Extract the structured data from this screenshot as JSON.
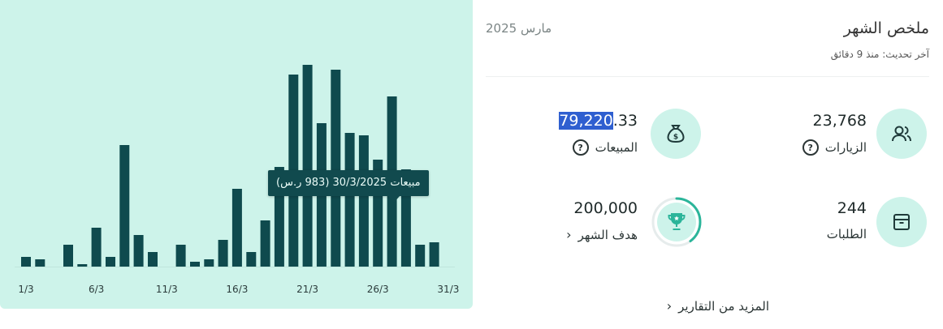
{
  "chart_data": {
    "type": "bar",
    "categories": [
      "1/3",
      "2/3",
      "3/3",
      "4/3",
      "5/3",
      "6/3",
      "7/3",
      "8/3",
      "9/3",
      "10/3",
      "11/3",
      "12/3",
      "13/3",
      "14/3",
      "15/3",
      "16/3",
      "17/3",
      "18/3",
      "19/3",
      "20/3",
      "21/3",
      "22/3",
      "23/3",
      "24/3",
      "25/3",
      "26/3",
      "27/3",
      "28/3",
      "29/3",
      "30/3",
      "31/3"
    ],
    "values": [
      4,
      3,
      0,
      9,
      1,
      16,
      4,
      50,
      13,
      6,
      0,
      9,
      2,
      3,
      11,
      32,
      6,
      19,
      41,
      79,
      83,
      59,
      81,
      55,
      54,
      44,
      70,
      40,
      9,
      10,
      0
    ],
    "tick_labels": [
      "1/3",
      "6/3",
      "11/3",
      "16/3",
      "21/3",
      "26/3",
      "31/3"
    ],
    "bar_color": "#0f4a4e",
    "ylim": [
      0,
      100
    ],
    "grid": false
  },
  "tooltip": {
    "text": "مبيعات 30/3/2025 (983 ر.س)"
  },
  "summary": {
    "title": "ملخص الشهر",
    "period": "مارس 2025",
    "updated": "آخر تحديث: منذ 9 دقائق",
    "metrics": {
      "visits": {
        "value": "23,768",
        "label": "الزيارات",
        "icon": "users-icon"
      },
      "sales": {
        "value_selected": "79,220",
        "value_rest": ".33",
        "label": "المبيعات",
        "icon": "money-bag-icon"
      },
      "orders": {
        "value": "244",
        "label": "الطلبات",
        "icon": "box-icon"
      },
      "goal": {
        "value": "200,000",
        "label": "هدف الشهر",
        "icon": "trophy-icon",
        "progress": 0.4
      }
    },
    "help_glyph": "?",
    "chevron": "‹",
    "more_reports": "المزيد من التقارير"
  },
  "colors": {
    "accent": "#2bb59a",
    "panel": "#cdf3ea",
    "bar": "#0f4a4e"
  }
}
